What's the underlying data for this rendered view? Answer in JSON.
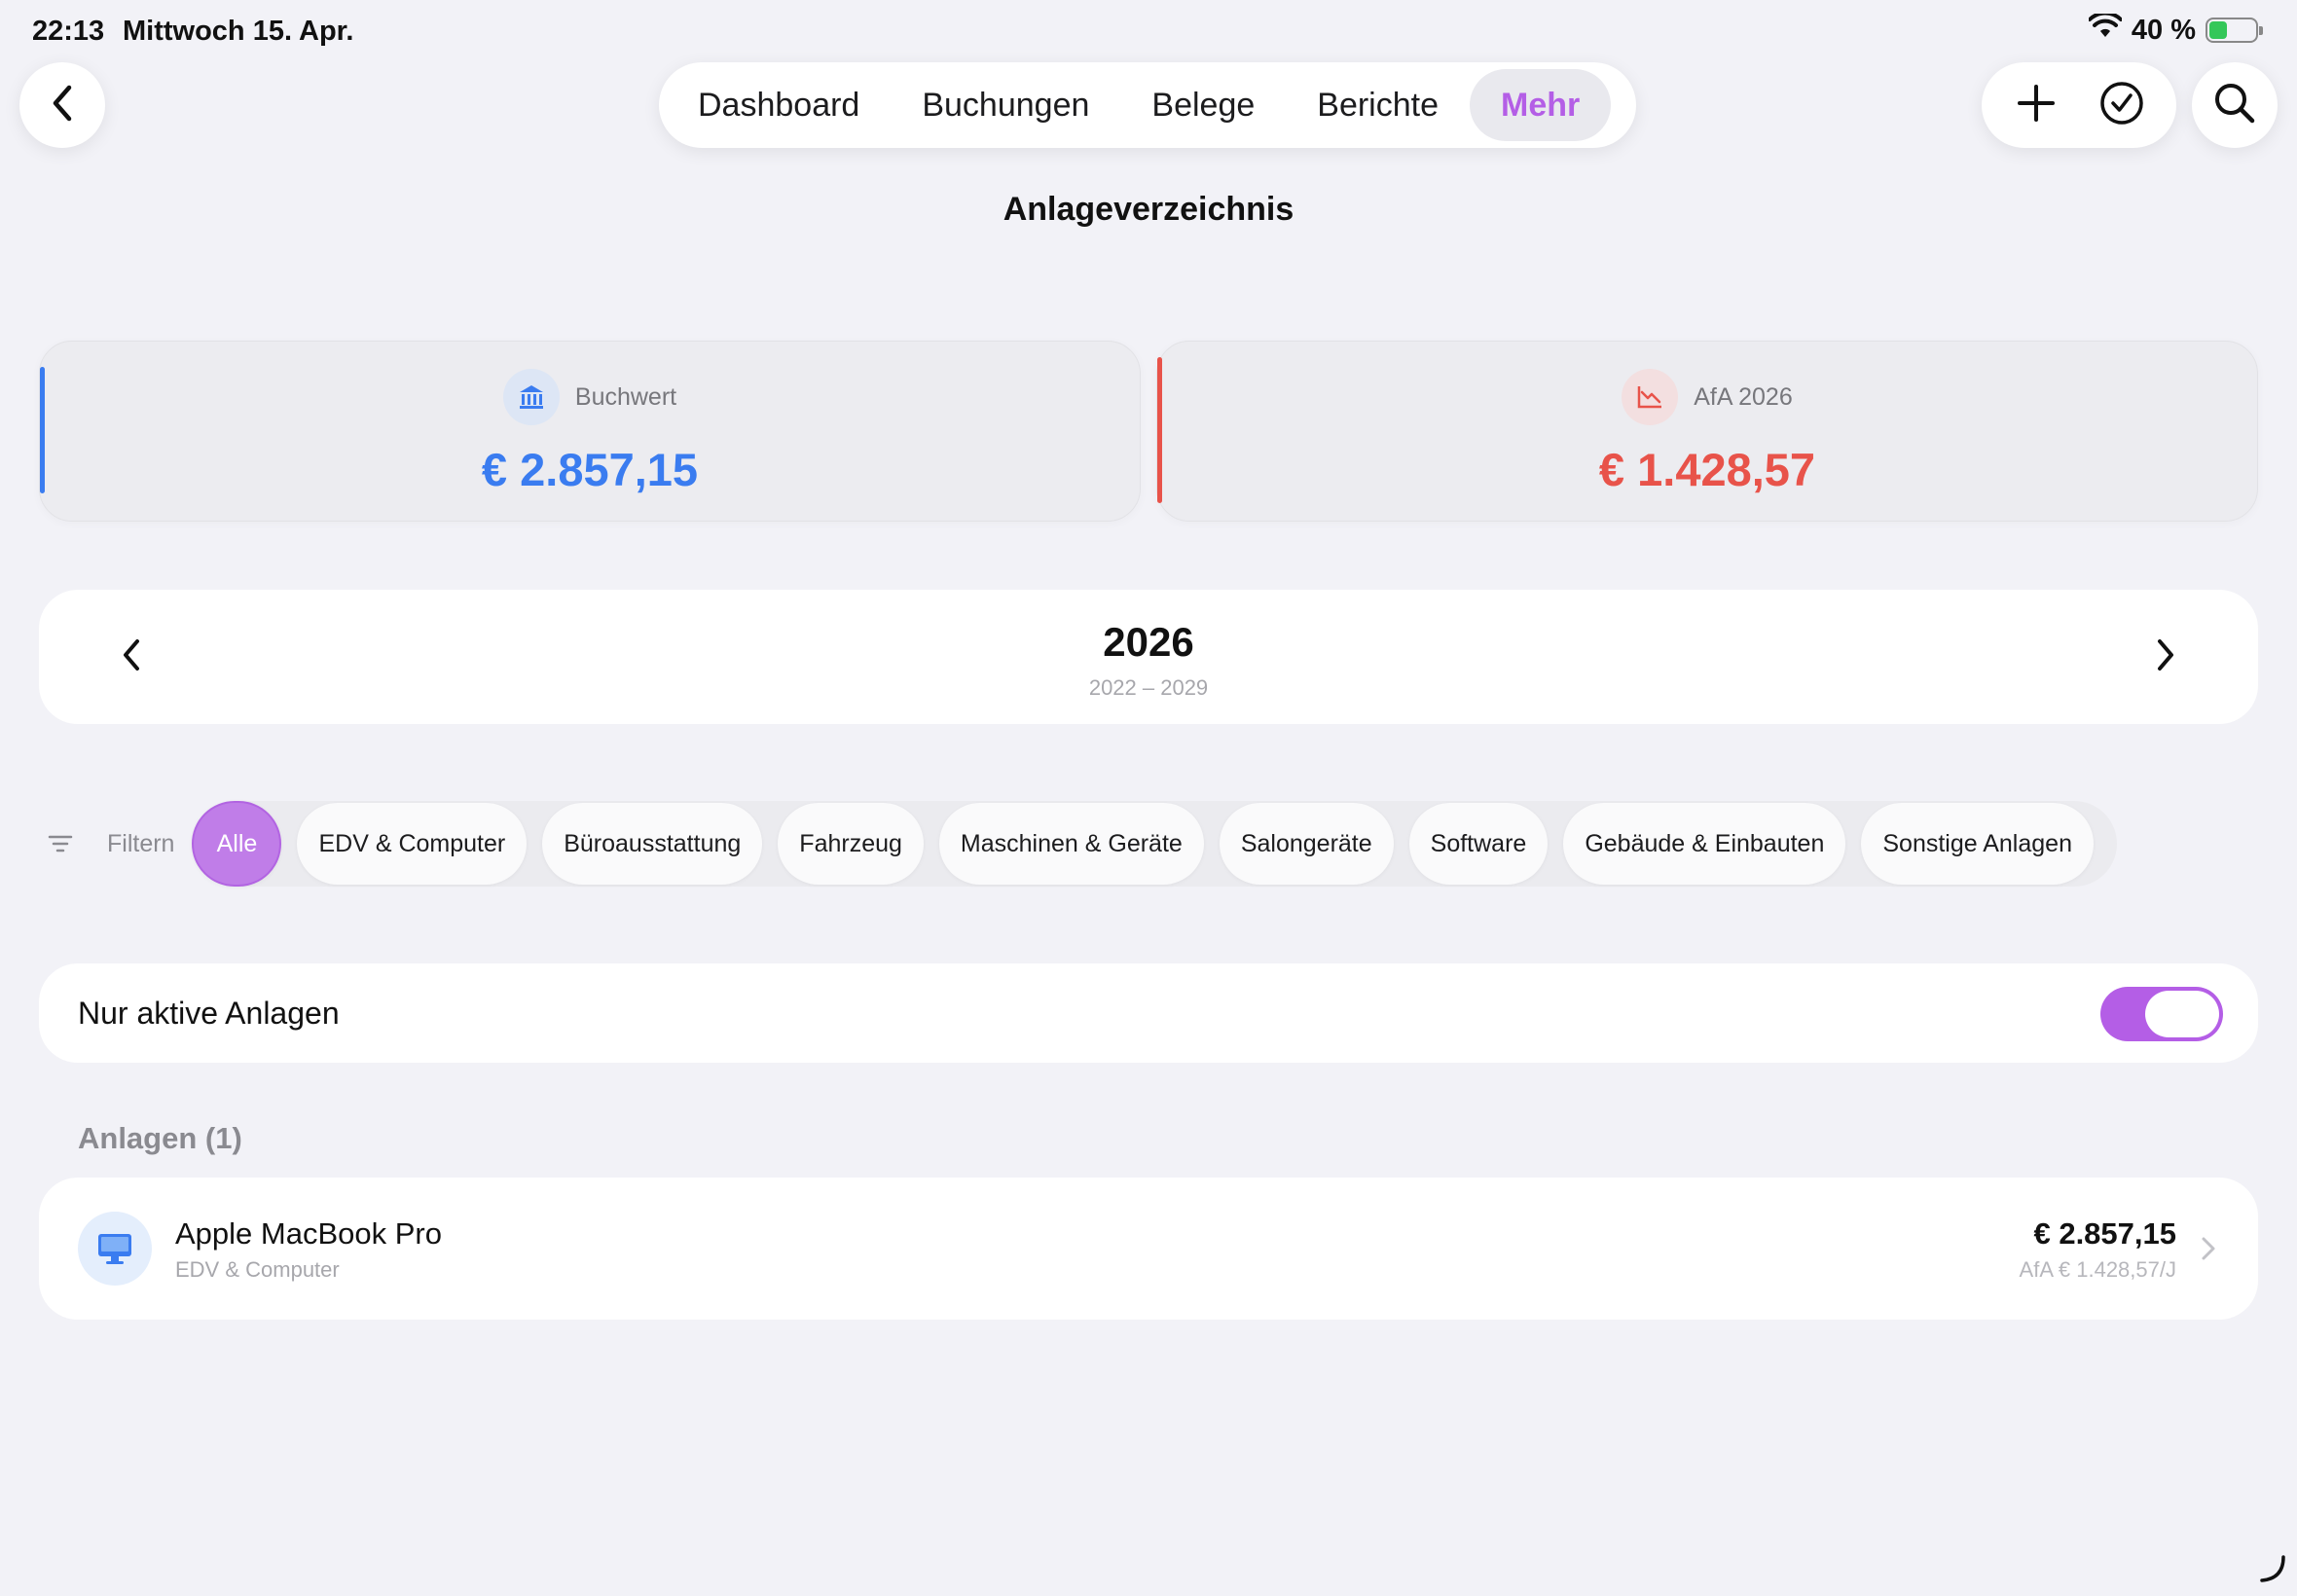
{
  "status_bar": {
    "time": "22:13",
    "date": "Mittwoch 15. Apr.",
    "battery": "40 %",
    "battery_level": 0.4
  },
  "nav": {
    "tabs": [
      {
        "label": "Dashboard",
        "active": false
      },
      {
        "label": "Buchungen",
        "active": false
      },
      {
        "label": "Belege",
        "active": false
      },
      {
        "label": "Berichte",
        "active": false
      },
      {
        "label": "Mehr",
        "active": true
      }
    ]
  },
  "page": {
    "title": "Anlageverzeichnis"
  },
  "summary": {
    "book_value": {
      "label": "Buchwert",
      "value": "€ 2.857,15",
      "icon": "bank-icon",
      "color": "#3a7cf0"
    },
    "depreciation": {
      "label": "AfA 2026",
      "value": "€ 1.428,57",
      "icon": "chart-down-icon",
      "color": "#e8534a"
    }
  },
  "year_selector": {
    "year": "2026",
    "range": "2022 – 2029"
  },
  "filter": {
    "label": "Filtern",
    "chips": [
      {
        "label": "Alle",
        "active": true
      },
      {
        "label": "EDV & Computer",
        "active": false
      },
      {
        "label": "Büroausstattung",
        "active": false
      },
      {
        "label": "Fahrzeug",
        "active": false
      },
      {
        "label": "Maschinen & Geräte",
        "active": false
      },
      {
        "label": "Salongeräte",
        "active": false
      },
      {
        "label": "Software",
        "active": false
      },
      {
        "label": "Gebäude & Einbauten",
        "active": false
      },
      {
        "label": "Sonstige Anlagen",
        "active": false
      }
    ]
  },
  "active_only": {
    "label": "Nur aktive Anlagen",
    "enabled": true
  },
  "assets": {
    "header": "Anlagen (1)",
    "items": [
      {
        "name": "Apple MacBook Pro",
        "category": "EDV & Computer",
        "value": "€ 2.857,15",
        "afa": "AfA € 1.428,57/J",
        "icon": "desktop-computer-icon"
      }
    ]
  },
  "colors": {
    "accent": "#b45ee6",
    "blue": "#3a7cf0",
    "red": "#e8534a",
    "background": "#f2f2f7"
  }
}
